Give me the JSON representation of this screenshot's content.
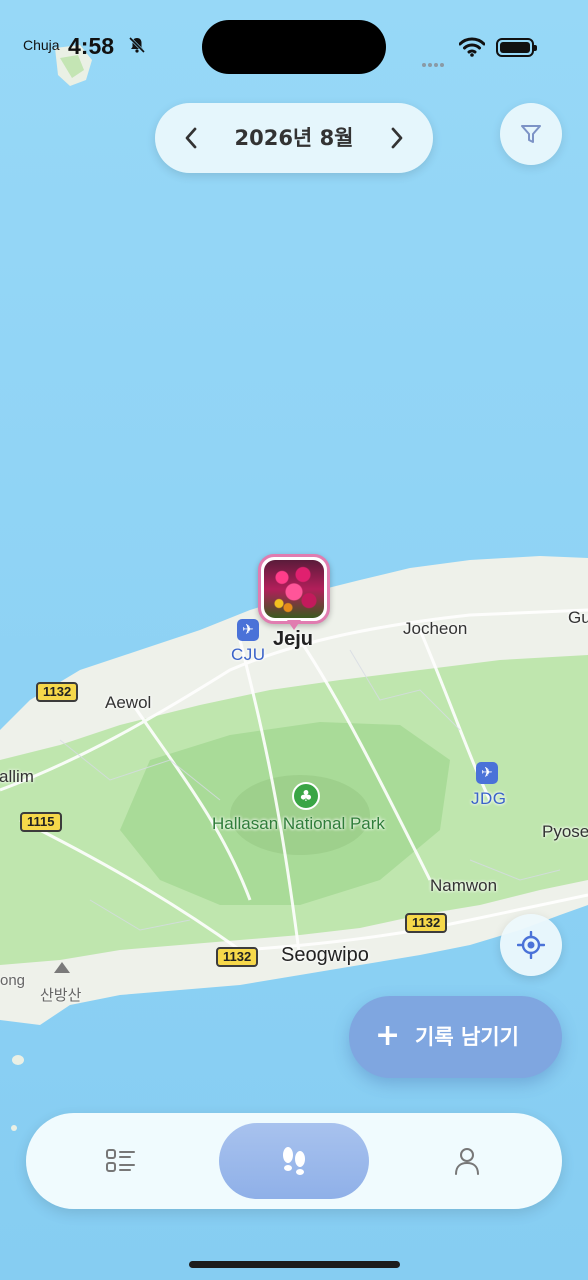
{
  "status_bar": {
    "carrier": "Chuja",
    "time": "4:58"
  },
  "header": {
    "month_label": "2026년 8월",
    "prev_icon": "chevron-left-icon",
    "next_icon": "chevron-right-icon",
    "filter_icon": "filter-icon"
  },
  "map": {
    "labels": {
      "jeju": "Jeju",
      "cju": "CJU",
      "jocheon": "Jocheon",
      "gu": "Gu",
      "aewol": "Aewol",
      "hallim": "allim",
      "jdg": "JDG",
      "hallasan": "Hallasan National Park",
      "pyoseon": "Pyose",
      "namwon": "Namwon",
      "seogwipo": "Seogwipo",
      "ong": "ong",
      "sanbangsan": "산방산"
    },
    "road_numbers": {
      "r1": "1132",
      "r2": "1115",
      "r3": "1132",
      "r4": "1132"
    },
    "colors": {
      "sea": "#8fd3f5",
      "land": "#eef1ea",
      "forest": "#b7e3a6",
      "pin_border": "#e17cb0"
    }
  },
  "actions": {
    "record_plus": "+",
    "record_label": "기록 남기기",
    "locate_icon": "crosshair-icon"
  },
  "tab_bar": {
    "tabs": [
      {
        "icon": "list-icon",
        "selected": false
      },
      {
        "icon": "footprints-icon",
        "selected": true
      },
      {
        "icon": "person-icon",
        "selected": false
      }
    ]
  }
}
